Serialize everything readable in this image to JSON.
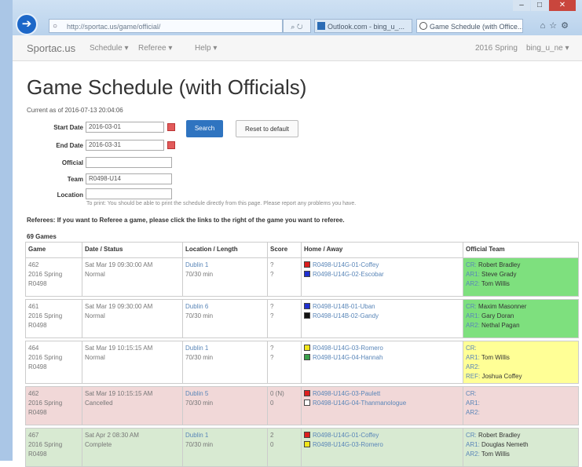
{
  "browser": {
    "address": "http://sportac.us/game/official/",
    "tabs": [
      "Outlook.com - bing_u_...",
      "Game Schedule (with Office..."
    ]
  },
  "nav": {
    "brand": "Sportac.us",
    "menu": [
      "Schedule ▾",
      "Referee ▾",
      "Help ▾"
    ],
    "season": "2016 Spring",
    "user": "bing_u_ne ▾"
  },
  "page": {
    "title": "Game Schedule (with Officials)",
    "current": "Current as of 2016-07-13 20:04:06"
  },
  "form": {
    "start_label": "Start Date",
    "start_value": "2016-03-01",
    "end_label": "End Date",
    "end_value": "2016-03-31",
    "official_label": "Official",
    "official_value": "",
    "team_label": "Team",
    "team_value": "R0498-U14",
    "location_label": "Location",
    "location_value": "",
    "search_label": "Search",
    "reset_label": "Reset to default",
    "note": "To print: You should be able to print the schedule directly from this page. Please report any problems you have."
  },
  "referees_text": "Referees: If you want to Referee a game, please click the links to the right of the game you want to referee.",
  "games_count": "69 Games",
  "table": {
    "headers": [
      "Game",
      "Date / Status",
      "Location / Length",
      "Score",
      "Home / Away",
      "Official Team"
    ],
    "rows": [
      {
        "bg": "#ffffff",
        "official_bg": "#7ee07e",
        "game": [
          "462",
          "2016 Spring",
          "R0498"
        ],
        "date": "Sat Mar 19 09:30:00 AM",
        "status": "Normal",
        "location": "Dublin 1",
        "length": "70/30 min",
        "score": [
          "?",
          "?"
        ],
        "teams": [
          {
            "color": "#dd1e1e",
            "name": "R0498-U14G-01-Coffey"
          },
          {
            "color": "#1f2fd0",
            "name": "R0498-U14G-02-Escobar"
          }
        ],
        "officials": [
          {
            "role": "CR:",
            "name": "Robert Bradley"
          },
          {
            "role": "AR1:",
            "name": "Steve Grady"
          },
          {
            "role": "AR2:",
            "name": "Tom Willis"
          }
        ]
      },
      {
        "bg": "#ffffff",
        "official_bg": "#7ee07e",
        "game": [
          "461",
          "2016 Spring",
          "R0498"
        ],
        "date": "Sat Mar 19 09:30:00 AM",
        "status": "Normal",
        "location": "Dublin 6",
        "length": "70/30 min",
        "score": [
          "?",
          "?"
        ],
        "teams": [
          {
            "color": "#1f2fd0",
            "name": "R0498-U14B-01-Uban"
          },
          {
            "color": "#111111",
            "name": "R0498-U14B-02-Gandy"
          }
        ],
        "officials": [
          {
            "role": "CR:",
            "name": "Maxim Masonner"
          },
          {
            "role": "AR1:",
            "name": "Gary Doran"
          },
          {
            "role": "AR2:",
            "name": "Nethal Pagan"
          }
        ]
      },
      {
        "bg": "#ffffff",
        "official_bg": "#ffff96",
        "game": [
          "464",
          "2016 Spring",
          "R0498"
        ],
        "date": "Sat Mar 19 10:15:15 AM",
        "status": "Normal",
        "location": "Dublin 1",
        "length": "70/30 min",
        "score": [
          "?",
          "?"
        ],
        "teams": [
          {
            "color": "#f2e61a",
            "name": "R0498-U14G-03-Romero"
          },
          {
            "color": "#3aa14a",
            "name": "R0498-U14G-04-Hannah"
          }
        ],
        "officials": [
          {
            "role": "CR:",
            "name": ""
          },
          {
            "role": "AR1:",
            "name": "Tom Willis"
          },
          {
            "role": "AR2:",
            "name": ""
          },
          {
            "role": "REF:",
            "name": "Joshua Coffey"
          }
        ]
      },
      {
        "bg": "#f1d8d8",
        "official_bg": "#f1d8d8",
        "game": [
          "462",
          "2016 Spring",
          "R0498"
        ],
        "date": "Sat Mar 19 10:15:15 AM",
        "status": "Cancelled",
        "location": "Dublin 5",
        "length": "70/30 min",
        "score": [
          "0 (N)",
          "0"
        ],
        "teams": [
          {
            "color": "#dd1e1e",
            "name": "R0498-U14G-03-Paulett"
          },
          {
            "color": "#ffffff",
            "name": "R0498-U14G-04-Thanmanologue"
          }
        ],
        "officials": [
          {
            "role": "CR:",
            "name": ""
          },
          {
            "role": "AR1:",
            "name": ""
          },
          {
            "role": "AR2:",
            "name": ""
          }
        ]
      },
      {
        "bg": "#d8ead2",
        "official_bg": "#d8ead2",
        "game": [
          "467",
          "2016 Spring",
          "R0498"
        ],
        "date": "Sat Apr 2 08:30 AM",
        "status": "Complete",
        "location": "Dublin 1",
        "length": "70/30 min",
        "score": [
          "2",
          "0"
        ],
        "teams": [
          {
            "color": "#dd1e1e",
            "name": "R0498-U14G-01-Coffey"
          },
          {
            "color": "#f2e61a",
            "name": "R0498-U14G-03-Romero"
          }
        ],
        "officials": [
          {
            "role": "CR:",
            "name": "Robert Bradley"
          },
          {
            "role": "AR1:",
            "name": "Douglas Nemeth"
          },
          {
            "role": "AR2:",
            "name": "Tom Willis"
          }
        ]
      }
    ]
  }
}
